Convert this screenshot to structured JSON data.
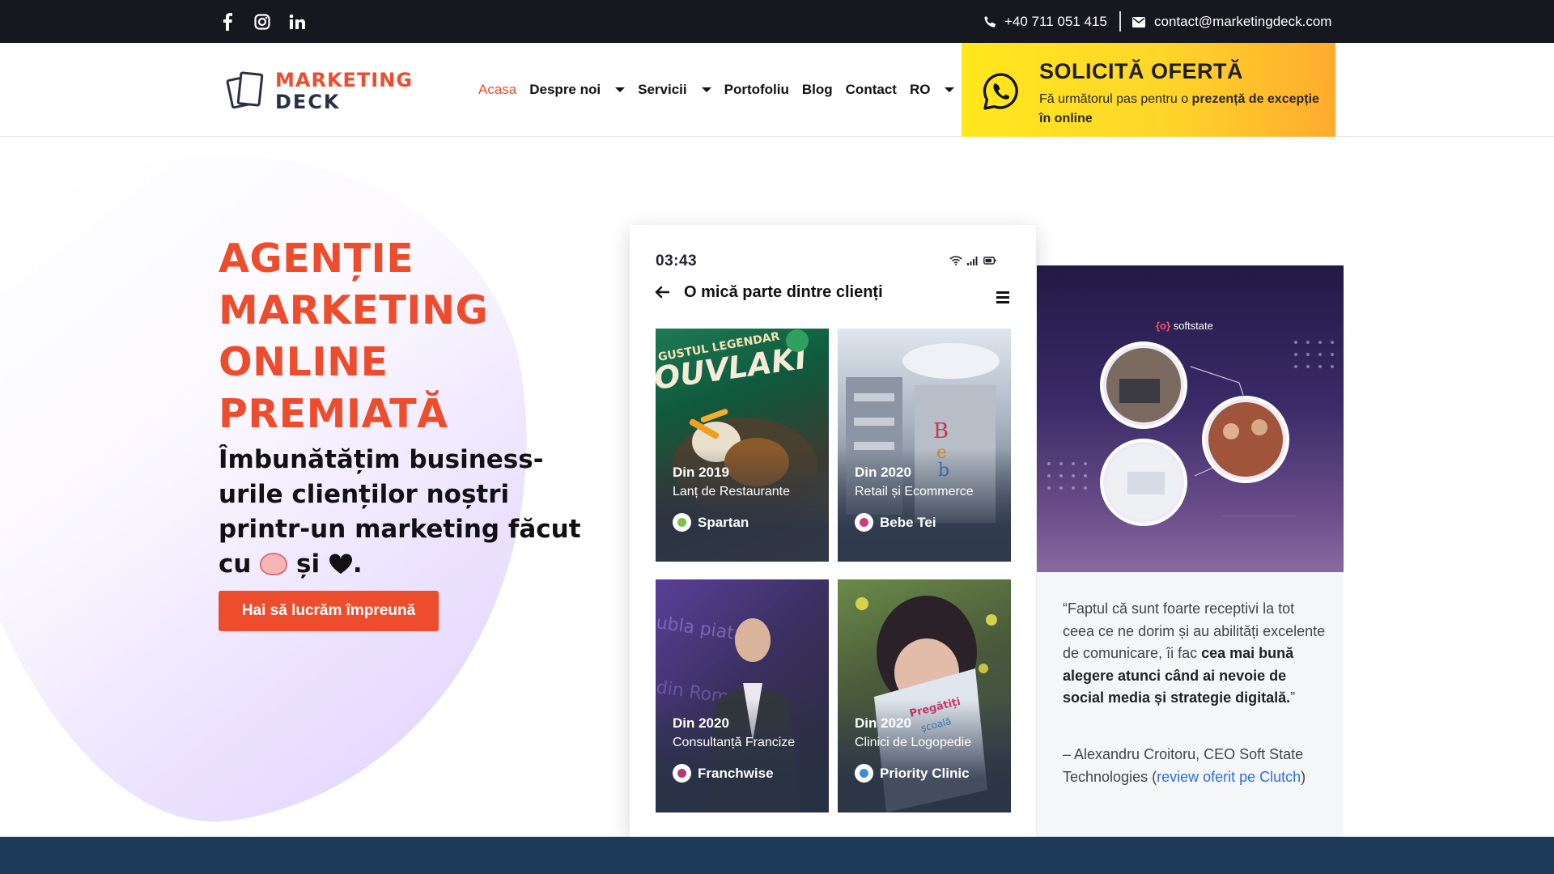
{
  "topbar": {
    "social": [
      {
        "name": "facebook-icon"
      },
      {
        "name": "instagram-icon"
      },
      {
        "name": "linkedin-icon"
      }
    ],
    "phone": "+40 711 051 415",
    "email": "contact@marketingdeck.com"
  },
  "header": {
    "logo_line1": "MARKETING",
    "logo_line2": "DECK",
    "nav": [
      {
        "label": "Acasa",
        "active": true,
        "dropdown": false
      },
      {
        "label": "Despre noi",
        "active": false,
        "dropdown": true
      },
      {
        "label": "Servicii",
        "active": false,
        "dropdown": true
      },
      {
        "label": "Portofoliu",
        "active": false,
        "dropdown": false
      },
      {
        "label": "Blog",
        "active": false,
        "dropdown": false
      },
      {
        "label": "Contact",
        "active": false,
        "dropdown": false
      },
      {
        "label": "RO",
        "active": false,
        "dropdown": true
      }
    ],
    "offer": {
      "title": "SOLICITĂ OFERTĂ",
      "sub_a": "Fă următorul pas pentru o ",
      "sub_b": "prezență de excepție în online"
    }
  },
  "hero": {
    "title": "AGENȚIE MARKETING ONLINE PREMIATĂ",
    "subtitle_a": "Îmbunătățim business-urile clienților noștri printr-un marketing făcut cu ",
    "subtitle_b": " și ",
    "subtitle_c": ".",
    "cta": "Hai să lucrăm împreună"
  },
  "phone": {
    "time": "03:43",
    "title": "O mică parte dintre clienți",
    "clients": [
      {
        "year": "Din 2019",
        "category": "Lanț de Restaurante",
        "name": "Spartan",
        "badge_color": "#7cc24a"
      },
      {
        "year": "Din 2020",
        "category": "Retail și Ecommerce",
        "name": "Bebe Tei",
        "badge_color": "#d33a7a"
      },
      {
        "year": "Din 2020",
        "category": "Consultanță Francize",
        "name": "Franchwise",
        "badge_color": "#b8396b"
      },
      {
        "year": "Din 2020",
        "category": "Clinici de Logopedie",
        "name": "Priority Clinic",
        "badge_color": "#3a8fd6"
      }
    ]
  },
  "testimonial": {
    "brand_a": "{o}",
    "brand_b": "softstate",
    "quote_a": "“Faptul că sunt foarte receptivi la tot ceea ce ne dorim și au abilități excelente de comunicare, îi fac ",
    "quote_b": "cea mai bună alegere atunci când ai nevoie de social media și strategie digitală.",
    "quote_c": "”",
    "author": "– Alexandru Croitoru, CEO Soft State Technologies (",
    "link": "review oferit pe Clutch",
    "author_end": ")"
  },
  "colors": {
    "accent": "#ee4d2d",
    "topbar": "#17171f",
    "offer_gradient": [
      "#ffe81c",
      "#ffab2e"
    ],
    "footer_band": "#1e3a5a"
  }
}
